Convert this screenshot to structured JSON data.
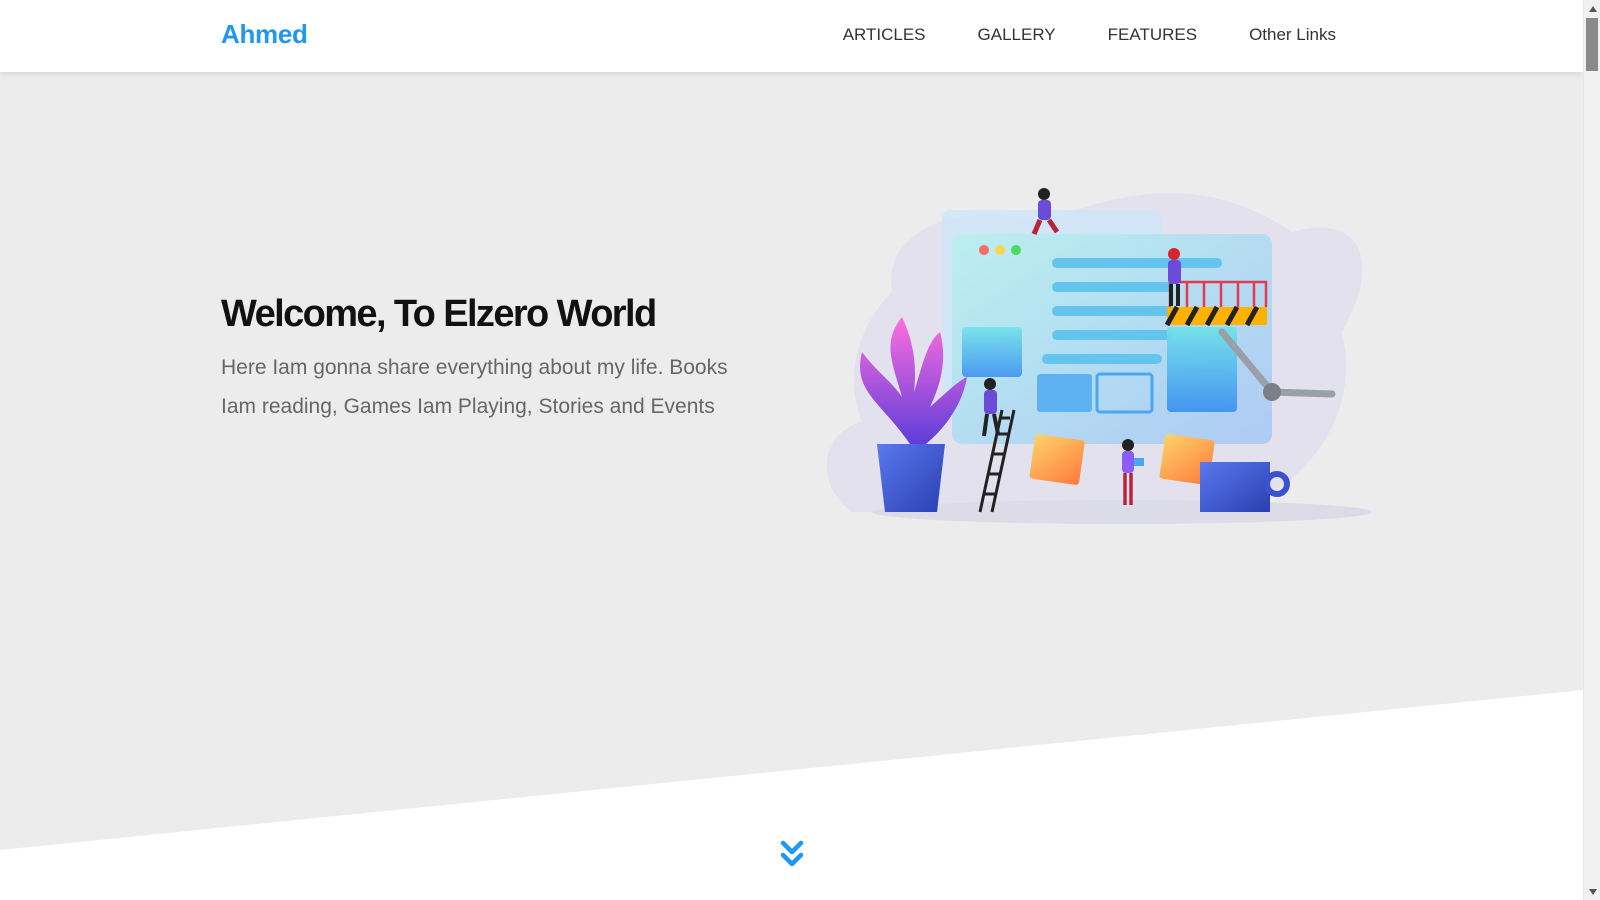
{
  "header": {
    "logo": "Ahmed",
    "nav": [
      {
        "label": "ARTICLES"
      },
      {
        "label": "GALLERY"
      },
      {
        "label": "FEATURES"
      },
      {
        "label": "Other Links"
      }
    ]
  },
  "landing": {
    "title": "Welcome, To Elzero World",
    "description": "Here Iam gonna share everything about my life. Books Iam reading, Games Iam Playing, Stories and Events"
  },
  "colors": {
    "accent": "#2196f3",
    "landing_bg": "#ececec",
    "title": "#111111",
    "text": "#666666"
  },
  "icons": {
    "go_down": "double-chevron-down-icon",
    "scroll_up": "triangle-up-icon",
    "scroll_down": "triangle-down-icon"
  }
}
